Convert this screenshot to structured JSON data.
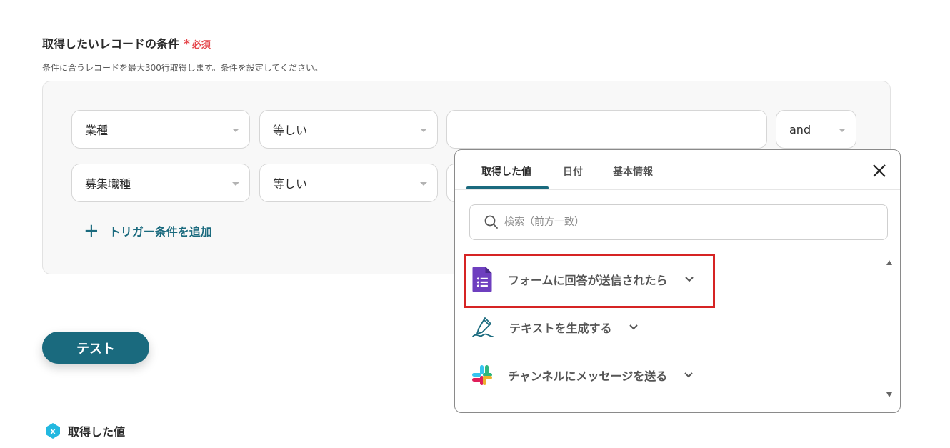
{
  "section": {
    "title": "取得したいレコードの条件",
    "required": "必須",
    "description": "条件に合うレコードを最大300行取得します。条件を設定してください。"
  },
  "conditions": [
    {
      "field": "業種",
      "operator": "等しい",
      "value": "",
      "joiner": "and"
    },
    {
      "field": "募集職種",
      "operator": "等しい"
    }
  ],
  "add_condition_label": "トリガー条件を追加",
  "test_button": "テスト",
  "values_label": "取得した値",
  "popup": {
    "tabs": [
      "取得した値",
      "日付",
      "基本情報"
    ],
    "active_tab": 0,
    "search_placeholder": "検索（前方一致）",
    "items": [
      {
        "label": "フォームに回答が送信されたら",
        "icon": "google-forms-icon",
        "highlighted": true
      },
      {
        "label": "テキストを生成する",
        "icon": "pen-icon",
        "highlighted": false
      },
      {
        "label": "チャンネルにメッセージを送る",
        "icon": "slack-icon",
        "highlighted": false
      }
    ]
  },
  "colors": {
    "accent": "#1a6a7e",
    "required": "#e5484d",
    "highlight": "#d62424"
  }
}
